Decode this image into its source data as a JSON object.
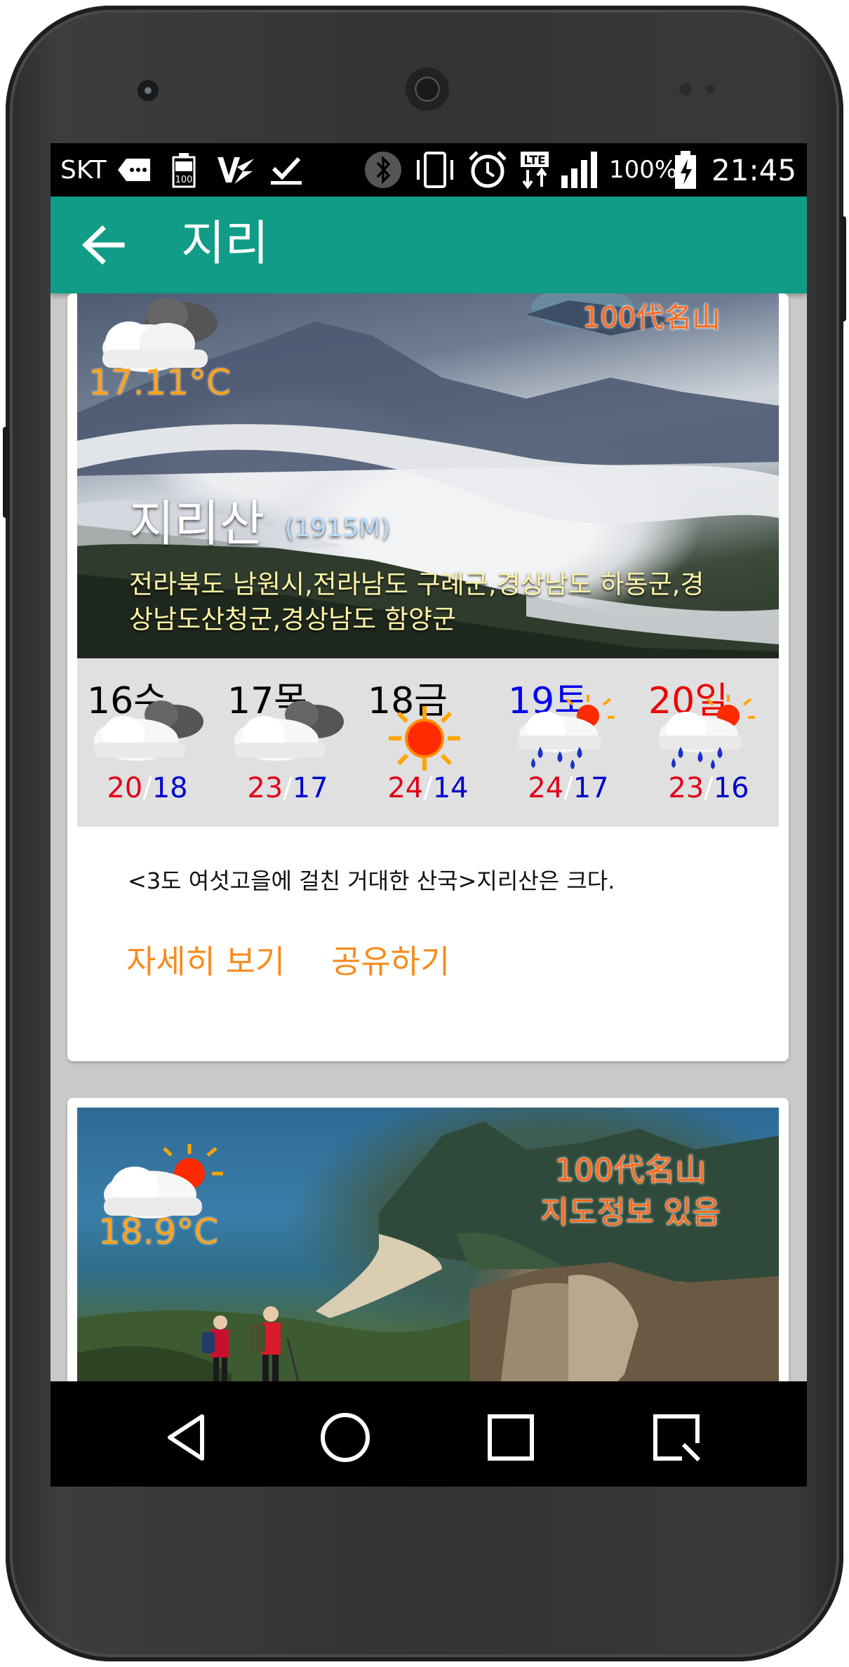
{
  "status_bar": {
    "carrier": "SKT",
    "battery_badge": "100",
    "lte": "LTE",
    "battery_percent": "100%",
    "time": "21:45",
    "icons": [
      "message-icon",
      "battery-small-icon",
      "vpn-icon",
      "download-icon",
      "bluetooth-icon",
      "vibrate-icon",
      "alarm-icon",
      "lte-icon",
      "signal-icon",
      "battery-charging-icon"
    ]
  },
  "app_bar": {
    "title": "지리",
    "back_icon": "arrow-left-icon"
  },
  "card1": {
    "badge": "100代名山",
    "current_temp": "17.11°C",
    "weather_icon": "cloudy-icon",
    "mountain_name": "지리산",
    "elevation": "(1915M)",
    "location": "전라북도 남원시,전라남도 구례군,경상남도 하동군,경상남도산청군,경상남도 함양군",
    "location_line1": "전라북도 남원시,전라남도 구례군,경상남도 하동군,경",
    "location_line2": "상남도산청군,경상남도 함양군",
    "forecast": [
      {
        "day": "16수",
        "icon": "cloudy-icon",
        "high": "20",
        "low": "18",
        "day_color": "#000000"
      },
      {
        "day": "17목",
        "icon": "cloudy-icon",
        "high": "23",
        "low": "17",
        "day_color": "#000000"
      },
      {
        "day": "18금",
        "icon": "sunny-icon",
        "high": "24",
        "low": "14",
        "day_color": "#000000"
      },
      {
        "day": "19토",
        "icon": "rain-sun-icon",
        "high": "24",
        "low": "17",
        "day_color": "#0000ee"
      },
      {
        "day": "20일",
        "icon": "rain-sun-icon",
        "high": "23",
        "low": "16",
        "day_color": "#ee0000"
      }
    ],
    "temp_separator": "/",
    "description": "<3도 여섯고을에 걸친 거대한 산국>지리산은 크다.",
    "actions": {
      "details": "자세히 보기",
      "share": "공유하기"
    }
  },
  "card2": {
    "badge_line1": "100代名山",
    "badge_line2": "지도정보 있음",
    "current_temp": "18.9°C",
    "weather_icon": "partly-cloudy-icon"
  },
  "nav_bar": {
    "buttons": [
      "back-triangle-icon",
      "home-circle-icon",
      "recents-square-icon",
      "search-square-icon"
    ]
  },
  "colors": {
    "app_bar": "#109c86",
    "accent_orange": "#f68c1e",
    "high_temp": "#e0001a",
    "low_temp": "#0000cc"
  }
}
